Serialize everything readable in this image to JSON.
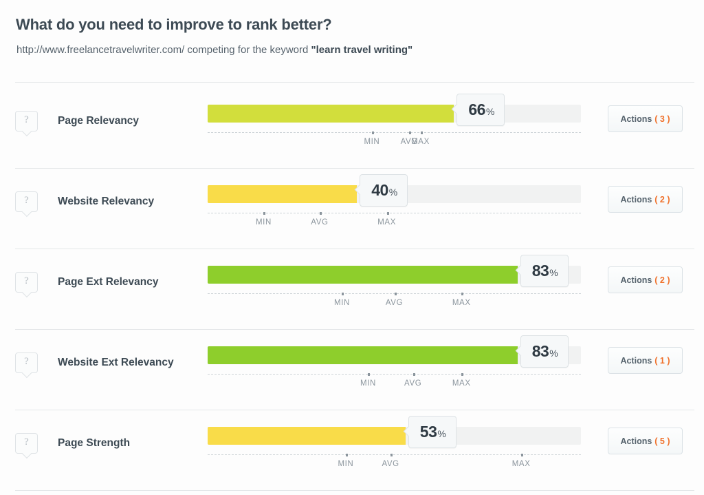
{
  "header": {
    "title": "What do you need to improve to rank better?",
    "url": "http://www.freelancetravelwriter.com/",
    "competing_text": " competing for the keyword ",
    "keyword": "\"learn travel writing\""
  },
  "scale_labels": {
    "min": "MIN",
    "avg": "AVG",
    "max": "MAX"
  },
  "actions_label": "Actions",
  "help_glyph": "?",
  "percent_symbol": "%",
  "colors": {
    "yellow_green": "#d2de3c",
    "yellow": "#f9dc49",
    "green": "#8ece2c",
    "track": "#f1f2f2",
    "accent_orange": "#f0702a",
    "text_dark": "#3d4a54",
    "text_muted": "#8b959d"
  },
  "chart_data": {
    "type": "bar",
    "title": "What do you need to improve to rank better?",
    "xlabel": "",
    "ylabel": "",
    "xlim": [
      0,
      100
    ],
    "categories": [
      "Page Relevancy",
      "Website Relevancy",
      "Page Ext Relevancy",
      "Website Ext Relevancy",
      "Page Strength"
    ],
    "values": [
      66,
      40,
      83,
      83,
      53
    ],
    "units": "%",
    "markers": {
      "min": [
        44,
        15,
        36,
        43,
        37
      ],
      "avg": [
        54,
        30,
        50,
        55,
        49
      ],
      "max": [
        57,
        48,
        68,
        68,
        84
      ]
    }
  },
  "rows": [
    {
      "name": "Page Relevancy",
      "value": 66,
      "color": "#d2de3c",
      "min_pct": 44,
      "avg_pct": 54,
      "max_pct": 57,
      "actions_count": "3"
    },
    {
      "name": "Website Relevancy",
      "value": 40,
      "color": "#f9dc49",
      "min_pct": 15,
      "avg_pct": 30,
      "max_pct": 48,
      "actions_count": "2"
    },
    {
      "name": "Page Ext Relevancy",
      "value": 83,
      "color": "#8ece2c",
      "min_pct": 36,
      "avg_pct": 50,
      "max_pct": 68,
      "actions_count": "2"
    },
    {
      "name": "Website Ext Relevancy",
      "value": 83,
      "color": "#8ece2c",
      "min_pct": 43,
      "avg_pct": 55,
      "max_pct": 68,
      "actions_count": "1"
    },
    {
      "name": "Page Strength",
      "value": 53,
      "color": "#f9dc49",
      "min_pct": 37,
      "avg_pct": 49,
      "max_pct": 84,
      "actions_count": "5"
    }
  ]
}
